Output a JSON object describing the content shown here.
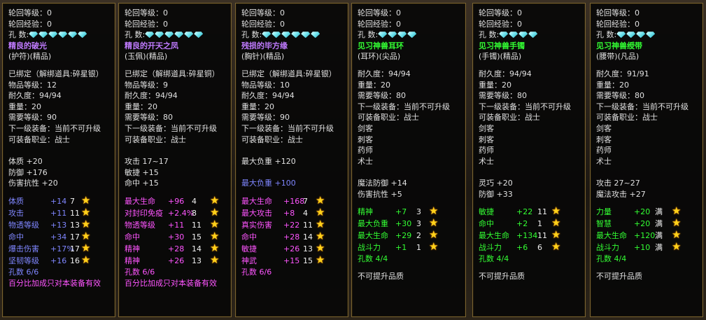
{
  "labels": {
    "reincarnation_level": "轮回等级：0",
    "reincarnation_exp": "轮回经验：0",
    "holes": "孔    数:",
    "bound": "已绑定（解绑道具:碎星银）",
    "bound_copper": "已绑定（解绑道具:碎星铜）",
    "next_upgrade": "下一级装备：当前不可升级",
    "profession_warrior": "可装备职业：战士"
  },
  "panels": [
    {
      "gems": 6,
      "name": "精良的破光",
      "name_color": "#c07bff",
      "type_line": "(护符)(精品)",
      "pre_lines": [
        "物品等级：12",
        "耐久度：94/94",
        "重量：20",
        "需要等级：90"
      ],
      "bound_key": "bound",
      "base_stats": [
        "体质 +20",
        "防御 +176",
        "伤害抗性 +20"
      ],
      "attrs": [
        {
          "label": "体质",
          "value": "+14",
          "level": "7"
        },
        {
          "label": "攻击",
          "value": "+11",
          "level": "11"
        },
        {
          "label": "物透等级",
          "value": "+13",
          "level": "13"
        },
        {
          "label": "命中",
          "value": "+34",
          "level": "17"
        },
        {
          "label": "爆击伤害",
          "value": "+17%",
          "level": "17"
        },
        {
          "label": "坚韧等级",
          "value": "+16",
          "level": "16"
        }
      ],
      "attr_color": "#7f86ff",
      "holes_line": "孔数 6/6",
      "footer": "百分比加成只对本装备有效",
      "footer_color": "#ff55ff"
    },
    {
      "gems": 6,
      "name": "精良的开天之凤",
      "name_color": "#c07bff",
      "type_line": "(玉佩)(精品)",
      "pre_lines": [
        "物品等级：9",
        "耐久度：94/94",
        "重量：20",
        "需要等级：80"
      ],
      "bound_key": "bound_copper",
      "base_stats": [
        "攻击 17~17",
        "敏捷 +15",
        "命中 +15"
      ],
      "attrs": [
        {
          "label": "最大生命",
          "value": "+96",
          "level": "4"
        },
        {
          "label": "对封印免疫",
          "value": "+2.4%",
          "level": "8"
        },
        {
          "label": "物透等级",
          "value": "+11",
          "level": "11"
        },
        {
          "label": "命中",
          "value": "+30",
          "level": "15"
        },
        {
          "label": "精神",
          "value": "+28",
          "level": "14"
        },
        {
          "label": "精神",
          "value": "+26",
          "level": "13"
        }
      ],
      "attr_color": "#ff55ff",
      "holes_line": "孔数 6/6",
      "footer": "百分比加成只对本装备有效",
      "footer_color": "#ff55ff"
    },
    {
      "gems": 6,
      "name": "残损的毕方缘",
      "name_color": "#c07bff",
      "type_line": "(胸针)(精品)",
      "pre_lines": [
        "物品等级：10",
        "耐久度：94/94",
        "重量：20",
        "需要等级：90"
      ],
      "bound_key": "bound",
      "base_stats": [
        "最大负重 +120",
        "",
        "最大负重 +100"
      ],
      "base_colors": [
        "#e0e0e0",
        "#e0e0e0",
        "#7f86ff"
      ],
      "attrs": [
        {
          "label": "最大生命",
          "value": "+168",
          "level": "7"
        },
        {
          "label": "最大攻击",
          "value": "+8",
          "level": "4"
        },
        {
          "label": "真实伤害",
          "value": "+22",
          "level": "11"
        },
        {
          "label": "命中",
          "value": "+28",
          "level": "14"
        },
        {
          "label": "敏捷",
          "value": "+26",
          "level": "13"
        },
        {
          "label": "神武",
          "value": "+15",
          "level": "15"
        }
      ],
      "attr_color": "#ff55ff",
      "holes_line": "孔数 6/6",
      "footer": "",
      "footer_color": "#ff55ff"
    },
    {
      "gems": 4,
      "name": "见习神兽耳环",
      "name_color": "#33ff33",
      "type_line": "(耳环)(尖品)",
      "pre_lines": [
        "耐久度：94/94",
        "重量：20",
        "需要等级：80"
      ],
      "bound_key": "",
      "base_stats": [
        "剑客",
        "刺客",
        "药师",
        "术士",
        "",
        "魔法防御 +14",
        "伤害抗性 +5"
      ],
      "attrs": [
        {
          "label": "精神",
          "value": "+7",
          "level": "3"
        },
        {
          "label": "最大负重",
          "value": "+30",
          "level": "3"
        },
        {
          "label": "最大生命",
          "value": "+29",
          "level": "2"
        },
        {
          "label": "战斗力",
          "value": "+1",
          "level": "1"
        }
      ],
      "attr_color": "#33ff33",
      "holes_line": "孔数 4/4",
      "footer": "不可提升品质",
      "footer_color": "#e0e0e0"
    },
    {
      "gems": 4,
      "name": "见习神兽手镯",
      "name_color": "#33ff33",
      "type_line": "(手镯)(精品)",
      "pre_lines": [
        "耐久度：94/94",
        "重量：20",
        "需要等级：80"
      ],
      "bound_key": "",
      "base_stats": [
        "剑客",
        "刺客",
        "药师",
        "术士",
        "",
        "灵巧 +20",
        "防御 +33"
      ],
      "attrs": [
        {
          "label": "敏捷",
          "value": "+22",
          "level": "11"
        },
        {
          "label": "命中",
          "value": "+2",
          "level": "1"
        },
        {
          "label": "最大生命",
          "value": "+134",
          "level": "11"
        },
        {
          "label": "战斗力",
          "value": "+6",
          "level": "6"
        }
      ],
      "attr_color": "#33ff33",
      "holes_line": "孔数 4/4",
      "footer": "不可提升品质",
      "footer_color": "#e0e0e0"
    },
    {
      "gems": 4,
      "name": "见习神兽绶带",
      "name_color": "#33ff33",
      "type_line": "(腰带)(凡品)",
      "pre_lines": [
        "耐久度：91/91",
        "重量：20",
        "需要等级：80"
      ],
      "bound_key": "",
      "base_stats": [
        "剑客",
        "刺客",
        "药师",
        "术士",
        "",
        "攻击 27~27",
        "魔法攻击 +27"
      ],
      "attrs": [
        {
          "label": "力量",
          "value": "+20",
          "level": "满"
        },
        {
          "label": "智慧",
          "value": "+20",
          "level": "满"
        },
        {
          "label": "最大生命",
          "value": "+120",
          "level": "满"
        },
        {
          "label": "战斗力",
          "value": "+10",
          "level": "满"
        }
      ],
      "attr_color": "#33ff33",
      "holes_line": "孔数 4/4",
      "footer": "不可提升品质",
      "footer_color": "#e0e0e0"
    }
  ]
}
